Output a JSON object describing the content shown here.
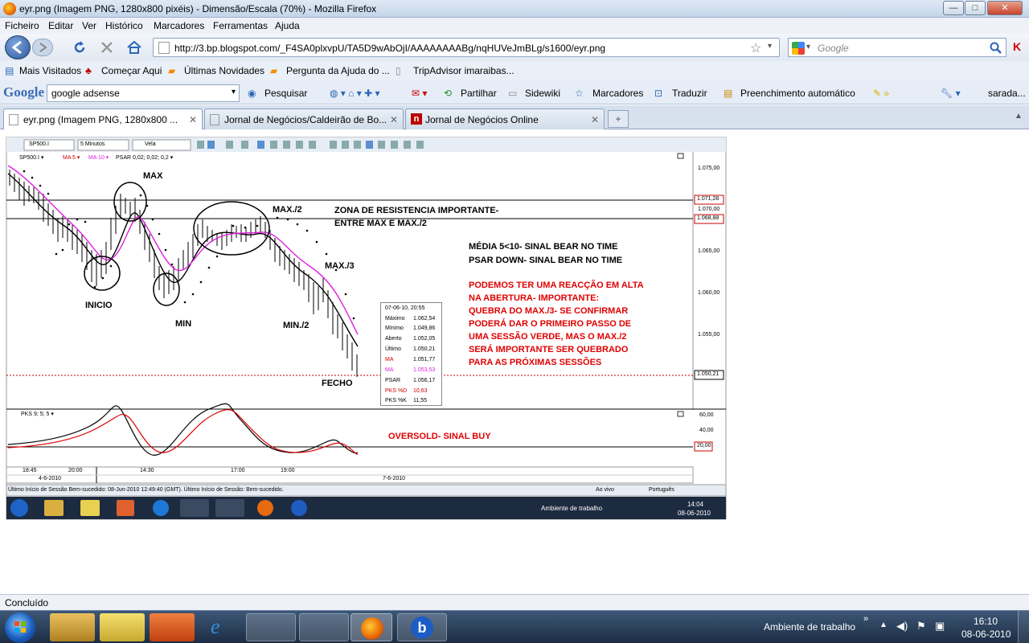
{
  "window": {
    "title": "eyr.png (Imagem PNG, 1280x800 pixéis) - Dimensão/Escala (70%) - Mozilla Firefox",
    "minimize": "—",
    "maximize": "□",
    "close": "✕"
  },
  "menu": [
    "Ficheiro",
    "Editar",
    "Ver",
    "Histórico",
    "Marcadores",
    "Ferramentas",
    "Ajuda"
  ],
  "address": {
    "url": "http://3.bp.blogspot.com/_F4SA0plxvpU/TA5D9wAbOjI/AAAAAAAABg/nqHUVeJmBLg/s1600/eyr.png",
    "search_placeholder": "Google"
  },
  "bookmarks": [
    "Mais Visitados",
    "Começar Aqui",
    "Últimas Novidades",
    "Pergunta da Ajuda do ...",
    "TripAdvisor imaraibas..."
  ],
  "google_toolbar": {
    "logo": "Google",
    "query": "google adsense",
    "items": [
      "Pesquisar",
      "Partilhar",
      "Sidewiki",
      "Marcadores",
      "Traduzir",
      "Preenchimento automático",
      "sarada..."
    ]
  },
  "tabs": [
    {
      "label": "eyr.png (Imagem PNG, 1280x800 ..."
    },
    {
      "label": "Jornal de Negócios/Caldeirão de Bo..."
    },
    {
      "label": "Jornal de Negócios Online"
    }
  ],
  "status": "Concluído",
  "taskbar": {
    "desktop_label": "Ambiente de trabalho",
    "time": "16:10",
    "date": "08-06-2010"
  },
  "platform": {
    "symbol": "SP500.I",
    "interval": "5 Minutos",
    "chart_style": "Vela",
    "legend": {
      "sym": "SP500.I ▾",
      "ma5": "MA 5 ▾",
      "ma10": "MA 10 ▾",
      "psar": "PSAR 0,02; 0,02; 0,2 ▾",
      "pks": "PKS 9; 5; 5 ▾"
    },
    "price_axis": [
      "1.075,00",
      "1.071,28",
      "1.070,00",
      "1.068,88",
      "1.065,00",
      "1.060,00",
      "1.055,00",
      "1.050,21"
    ],
    "osc_axis": [
      "60,00",
      "40,00",
      "20,00"
    ],
    "time_axis": [
      "18:45",
      "20:00",
      "14:30",
      "17:00",
      "19:00"
    ],
    "date_axis": [
      "4-6-2010",
      "7-6-2010"
    ],
    "status_line": "Último Início de Sessão Bem-sucedido: 08-Jun-2010 12:49:40 (GMT). Último Início de Sessão: Bem-sucedido.",
    "live": "Ao vivo",
    "lang": "Português",
    "inner_desktop": "Ambiente de trabalho",
    "inner_time": "14:04",
    "inner_date": "08-06-2010",
    "infobox": {
      "datetime": "07-06-10, 20:55",
      "rows": [
        [
          "Máximo",
          "1.062,54"
        ],
        [
          "Mínimo",
          "1.049,86"
        ],
        [
          "Aberto",
          "1.052,05"
        ],
        [
          "Último",
          "1.050,21"
        ],
        [
          "MA",
          "1.051,77"
        ],
        [
          "MA",
          "1.053,53"
        ],
        [
          "PSAR",
          "1.056,17"
        ],
        [
          "PKS %D",
          "10,63"
        ],
        [
          "PKS %K",
          "11,55"
        ]
      ]
    },
    "annotations": {
      "max": "MAX",
      "inicio": "INICIO",
      "min": "MIN",
      "max2": "MAX./2",
      "max3": "MAX./3",
      "min2": "MIN./2",
      "fecho": "FECHO",
      "zona1": "ZONA DE RESISTENCIA IMPORTANTE-",
      "zona2": "ENTRE MAX E MAX./2",
      "media1": "MÉDIA 5<10- SINAL BEAR NO TIME",
      "media2": "PSAR DOWN- SINAL BEAR NO TIME",
      "red": [
        "PODEMOS TER UMA REACÇÃO EM ALTA",
        "NA ABERTURA- IMPORTANTE:",
        "QUEBRA DO MAX./3- SE CONFIRMAR",
        "PODERÁ DAR O PRIMEIRO PASSO DE",
        "UMA SESSÃO VERDE, MAS O MAX./2",
        "SERÁ IMPORTANTE SER QUEBRADO",
        "PARA AS PRÓXIMAS SESSÕES"
      ],
      "oversold": "OVERSOLD- SINAL BUY"
    }
  },
  "colors": {
    "accent": "#3b6bb5",
    "ma5": "#000000",
    "ma10": "#e020e0",
    "red": "#e00000"
  }
}
